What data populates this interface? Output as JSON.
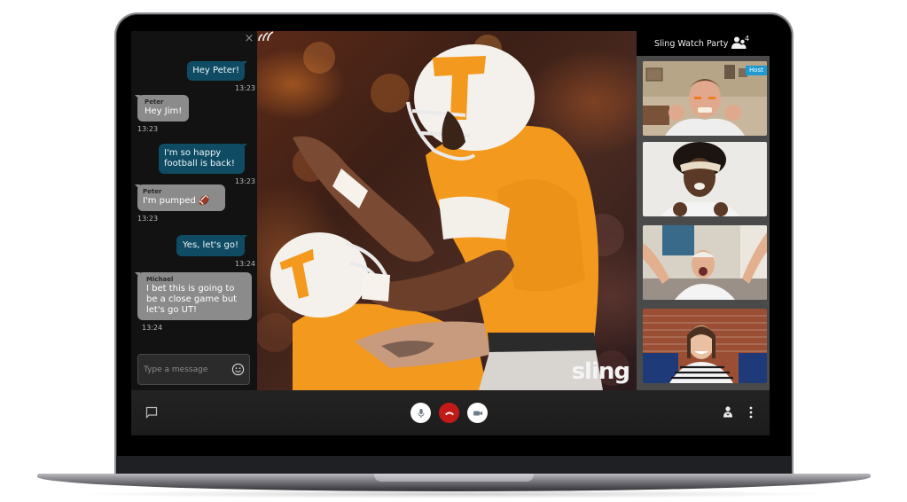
{
  "chat": {
    "close_label": "×",
    "messages": [
      {
        "direction": "out",
        "sender": "",
        "text": "Hey Peter!",
        "time": "13:23"
      },
      {
        "direction": "in",
        "sender": "Peter",
        "text": "Hey Jim!",
        "time": "13:23"
      },
      {
        "direction": "out",
        "sender": "",
        "text": "I'm so happy football is back!",
        "time": "13:23"
      },
      {
        "direction": "in",
        "sender": "Peter",
        "text": "I'm pumped 🏈",
        "time": "13:23"
      },
      {
        "direction": "out",
        "sender": "",
        "text": "Yes, let's go!",
        "time": "13:24"
      },
      {
        "direction": "in",
        "sender": "Michael",
        "text": "I bet this is going to be a close game but let's go UT!",
        "time": "13:24"
      }
    ],
    "input_placeholder": "Type a message",
    "input_value": "",
    "emoji_icon": "smiley-icon"
  },
  "video": {
    "brand_logo": "sling"
  },
  "party": {
    "title": "Sling Watch Party",
    "participant_count": "4",
    "host_badge": "Host",
    "participants": [
      {
        "role": "Host"
      },
      {
        "role": ""
      },
      {
        "role": ""
      },
      {
        "role": ""
      }
    ]
  },
  "controls": {
    "chat_icon": "chat-bubble-icon",
    "mic_icon": "microphone-icon",
    "end_call_icon": "hang-up-icon",
    "camera_icon": "video-camera-icon",
    "people_icon": "person-icon",
    "more_icon": "more-vertical-icon"
  },
  "colors": {
    "outgoing_bubble": "#0f4c63",
    "incoming_bubble": "#8b8b8b",
    "end_call": "#c21b17",
    "host_badge": "#1f9bd1",
    "team_orange": "#f39a1e"
  }
}
